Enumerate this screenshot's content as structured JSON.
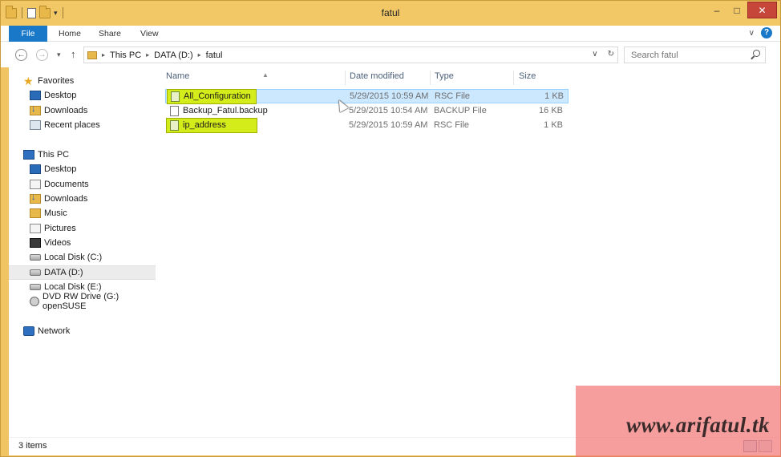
{
  "window": {
    "title": "fatul"
  },
  "titlebar": {
    "minimize": "–",
    "maximize": "□",
    "close": "✕",
    "qat_arrow": "▾"
  },
  "ribbon": {
    "tabs": [
      "File",
      "Home",
      "Share",
      "View"
    ],
    "expand": "∨",
    "help": "?"
  },
  "navigation": {
    "back": "←",
    "forward": "→",
    "recent": "▾",
    "up": "↑",
    "breadcrumb": [
      "This PC",
      "DATA (D:)",
      "fatul"
    ],
    "crumb_separator": "▸",
    "dropdown": "∨",
    "refresh": "↻",
    "search_placeholder": "Search fatul"
  },
  "sidebar": {
    "groups": [
      {
        "label": "Favorites",
        "icon": "star-icon",
        "items": [
          {
            "label": "Desktop",
            "icon": "desktop-icon"
          },
          {
            "label": "Downloads",
            "icon": "downloads-icon"
          },
          {
            "label": "Recent places",
            "icon": "recent-places-icon"
          }
        ]
      },
      {
        "label": "This PC",
        "icon": "computer-icon",
        "items": [
          {
            "label": "Desktop",
            "icon": "desktop-icon"
          },
          {
            "label": "Documents",
            "icon": "documents-icon"
          },
          {
            "label": "Downloads",
            "icon": "downloads-icon"
          },
          {
            "label": "Music",
            "icon": "music-icon"
          },
          {
            "label": "Pictures",
            "icon": "pictures-icon"
          },
          {
            "label": "Videos",
            "icon": "videos-icon"
          },
          {
            "label": "Local Disk (C:)",
            "icon": "local-disk-icon"
          },
          {
            "label": "DATA (D:)",
            "icon": "drive-icon",
            "selected": true
          },
          {
            "label": "Local Disk (E:)",
            "icon": "drive-icon"
          },
          {
            "label": "DVD RW Drive (G:) openSUSE",
            "icon": "dvd-drive-icon"
          }
        ]
      },
      {
        "label": "Network",
        "icon": "network-icon",
        "items": []
      }
    ]
  },
  "file_list": {
    "columns": [
      "Name",
      "Date modified",
      "Type",
      "Size"
    ],
    "sort_indicator": "▲",
    "rows": [
      {
        "name": "All_Configuration",
        "date": "5/29/2015 10:59 AM",
        "type": "RSC File",
        "size": "1 KB",
        "selected": true,
        "highlighted": true
      },
      {
        "name": "Backup_Fatul.backup",
        "date": "5/29/2015 10:54 AM",
        "type": "BACKUP File",
        "size": "16 KB",
        "selected": false,
        "highlighted": false
      },
      {
        "name": "ip_address",
        "date": "5/29/2015 10:59 AM",
        "type": "RSC File",
        "size": "1 KB",
        "selected": false,
        "highlighted": true
      }
    ]
  },
  "status": {
    "item_count": "3 items"
  },
  "watermark": {
    "text": "www.arifatul.tk"
  },
  "colors": {
    "title_bar": "#f2c867",
    "file_tab": "#1978c8",
    "close_button": "#c7463a",
    "selection": "#cce8ff",
    "highlight": "#d4ec1a",
    "watermark": "#f27878"
  }
}
